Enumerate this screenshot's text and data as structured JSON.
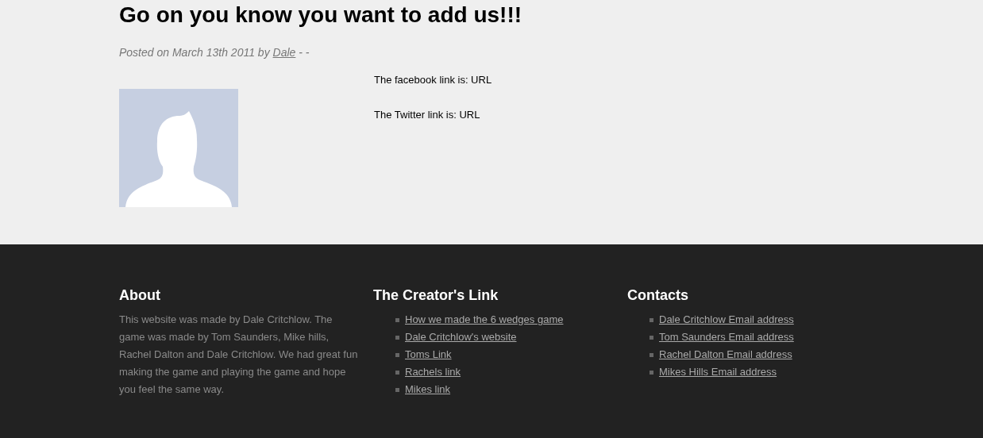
{
  "post": {
    "title": "Go on you know you want to add us!!!",
    "meta_before": "Posted on March 13th 2011 by",
    "author": "Dale",
    "meta_after": "- -",
    "lines": [
      "The facebook link is: URL",
      "The Twitter link is: URL"
    ]
  },
  "footer": {
    "about": {
      "heading": "About",
      "text": "This website was made by Dale Critchlow. The game was made by Tom Saunders, Mike hills, Rachel Dalton and Dale Critchlow. We had great fun making the game and playing the game and hope you feel the same way."
    },
    "columns": [
      {
        "heading": "The Creator's Link",
        "links": [
          "How we made the 6 wedges game",
          "Dale Critchlow's website",
          "Toms Link",
          "Rachels link",
          "Mikes link"
        ]
      },
      {
        "heading": "Contacts",
        "links": [
          "Dale Critchlow Email address",
          "Tom Saunders Email address",
          "Rachel Dalton Email address",
          "Mikes Hills Email address"
        ]
      }
    ]
  }
}
